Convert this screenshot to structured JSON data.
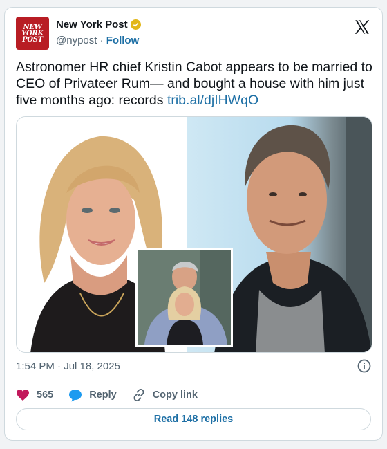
{
  "account": {
    "name": "New York Post",
    "handle": "@nypost",
    "separator": " · ",
    "follow_label": "Follow",
    "avatar_text": [
      "NEW",
      "YORK",
      "POST"
    ],
    "avatar_color": "#b81d24",
    "verified_color": "#e2b719",
    "verified_icon": "verified-badge-icon"
  },
  "tweet": {
    "text": "Astronomer HR chief Kristin Cabot appears to be married to CEO of Privateer Rum— and bought a house with him just five months ago: records ",
    "link": "trib.al/djIHWqO",
    "link_color": "#1d6fa5"
  },
  "meta": {
    "timestamp": "1:54 PM · Jul 18, 2025"
  },
  "actions": {
    "likes": "565",
    "reply_label": "Reply",
    "copy_label": "Copy link",
    "like_icon": "heart-icon",
    "reply_icon": "speech-bubble-icon",
    "copy_icon": "link-icon",
    "like_color": "#f91880",
    "reply_color": "#1d9bf0"
  },
  "footer": {
    "read_replies_label": "Read 148 replies"
  }
}
